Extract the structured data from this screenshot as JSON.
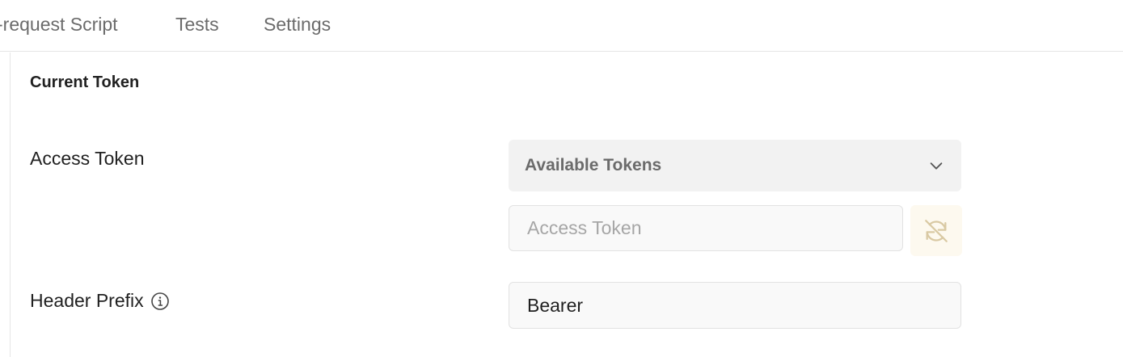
{
  "tabs": [
    {
      "label": "-request Script"
    },
    {
      "label": "Tests"
    },
    {
      "label": "Settings"
    }
  ],
  "section": {
    "title": "Current Token"
  },
  "access_token": {
    "label": "Access Token",
    "dropdown_label": "Available Tokens",
    "input_placeholder": "Access Token",
    "input_value": ""
  },
  "header_prefix": {
    "label": "Header Prefix",
    "input_value": "Bearer"
  },
  "icons": {
    "info": "info-icon",
    "chevron": "chevron-down-icon",
    "sync": "sync-disabled-icon"
  },
  "colors": {
    "sync_icon": "#d9c9a3",
    "sync_bg": "#fdf9ef",
    "dropdown_bg": "#f2f2f2"
  }
}
